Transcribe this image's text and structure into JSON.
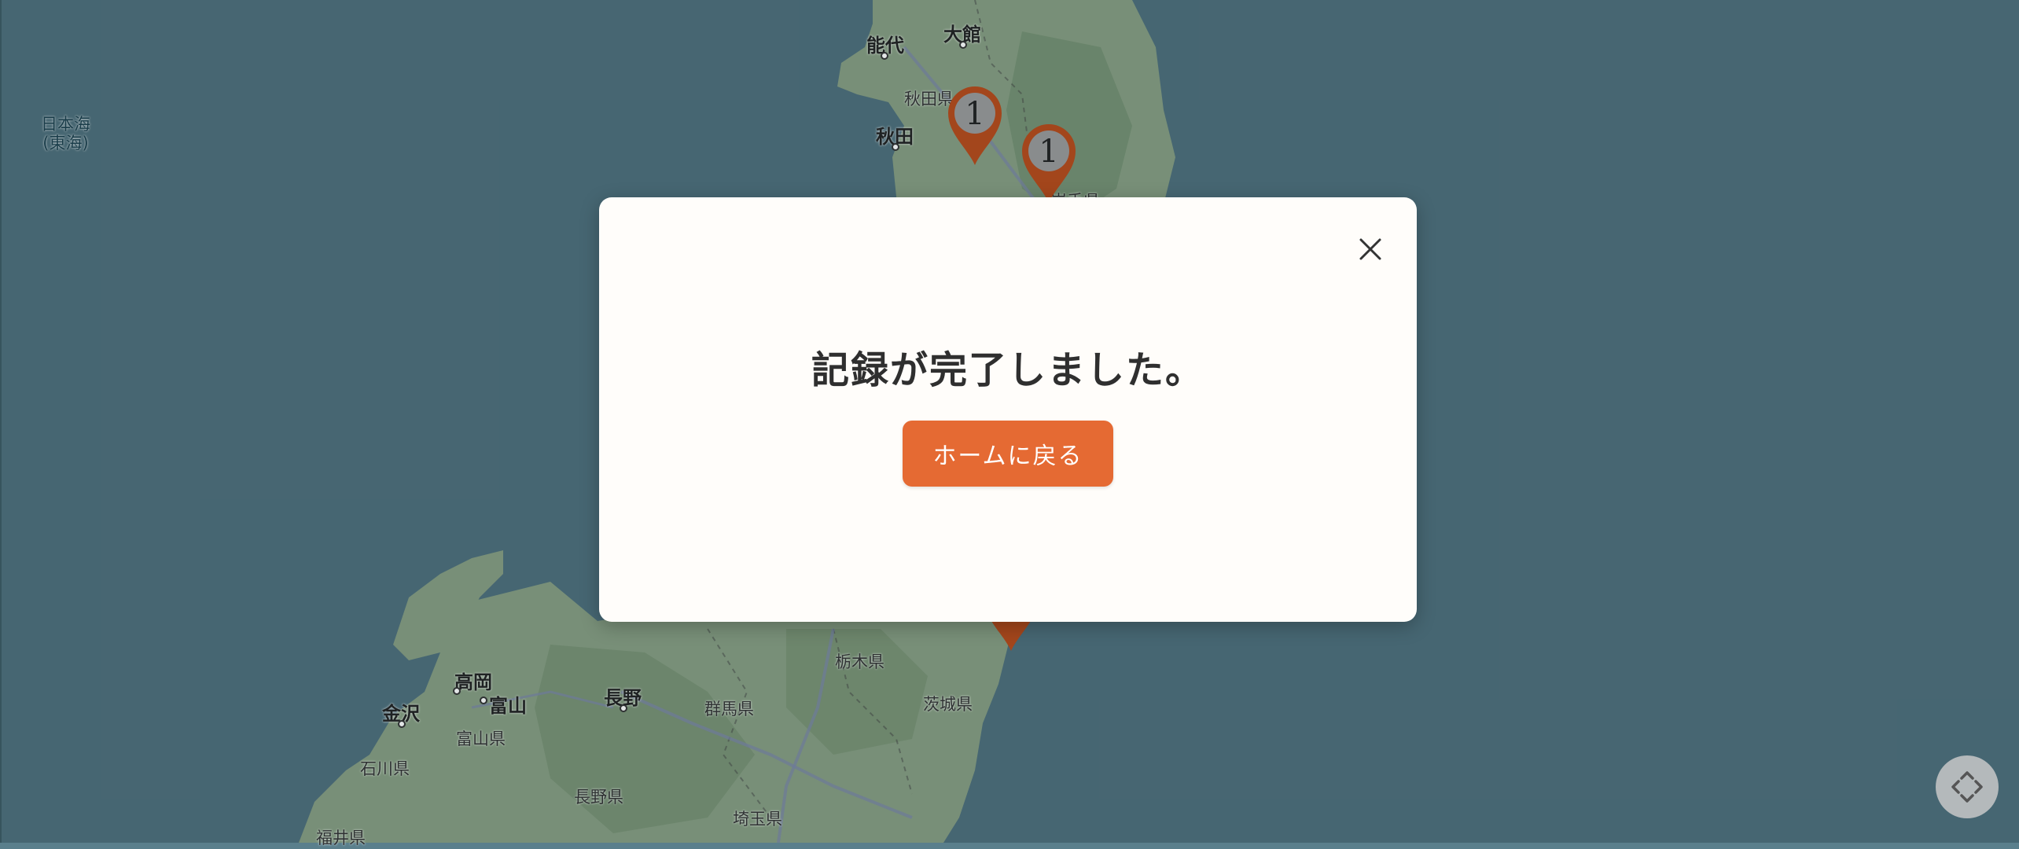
{
  "modal": {
    "title": "記録が完了しました。",
    "home_button_label": "ホームに戻る",
    "close_icon": "close-icon"
  },
  "map": {
    "sea_labels": {
      "japan_sea": "日本海",
      "japan_sea_alt": "(東海)"
    },
    "cities": {
      "noshiro": "能代",
      "odate": "大館",
      "akita": "秋田",
      "kanazawa": "金沢",
      "takaoka": "高岡",
      "toyama": "富山",
      "nagano": "長野"
    },
    "prefectures": {
      "akita_ken": "秋田県",
      "iwate_ken": "岩手県",
      "toyama_ken": "富山県",
      "ishikawa_ken": "石川県",
      "fukui_ken": "福井県",
      "nagano_ken": "長野県",
      "gunma_ken": "群馬県",
      "tochigi_ken": "栃木県",
      "ibaraki_ken": "茨城県",
      "saitama_ken": "埼玉県"
    },
    "pins": [
      {
        "count": "1",
        "color": "#b84a1a"
      },
      {
        "count": "1",
        "color": "#b84a1a"
      },
      {
        "count": "",
        "color": "#b84a1a"
      }
    ]
  },
  "controls": {
    "fullscreen_icon": "fullscreen-icon"
  },
  "colors": {
    "accent": "#e56a33",
    "modal_bg": "#fffdfa",
    "sea": "#5a7f8c",
    "land": "#8fa68a",
    "pin": "#b84a1a"
  }
}
